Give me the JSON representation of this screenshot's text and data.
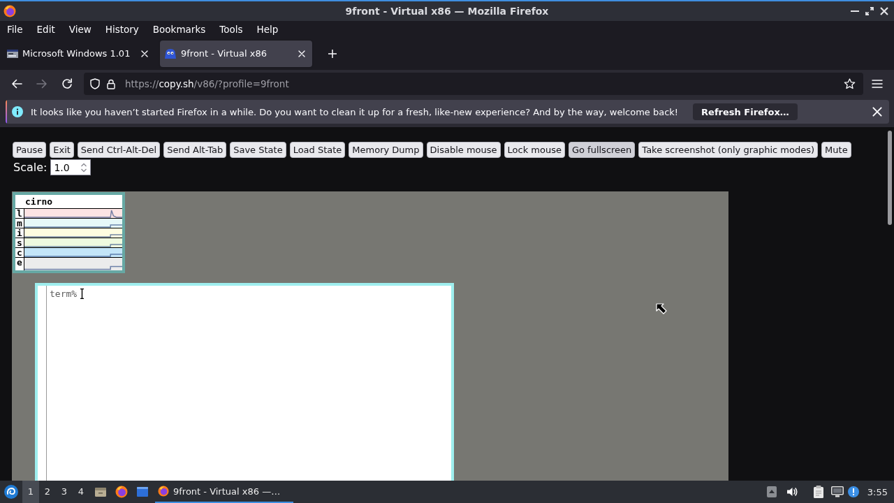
{
  "window": {
    "title": "9front - Virtual x86 — Mozilla Firefox"
  },
  "menu_bar": {
    "items": [
      "File",
      "Edit",
      "View",
      "History",
      "Bookmarks",
      "Tools",
      "Help"
    ]
  },
  "tabs": [
    {
      "title": "Microsoft Windows 1.01",
      "selected": false
    },
    {
      "title": "9front - Virtual x86",
      "selected": true
    }
  ],
  "nav_buttons": [
    {
      "kind": "back",
      "disabled": false
    },
    {
      "kind": "forward",
      "disabled": true
    },
    {
      "kind": "reload",
      "disabled": false
    }
  ],
  "address_bar": {
    "scheme": "https://",
    "host": "copy.sh",
    "path": "/v86/?profile=9front"
  },
  "notification": {
    "message": "It looks like you haven’t started Firefox in a while. Do you want to clean it up for a fresh, like-new experience? And by the way, welcome back!",
    "button": "Refresh Firefox…"
  },
  "page": {
    "buttons": [
      {
        "label": "Pause",
        "hovered": false
      },
      {
        "label": "Exit",
        "hovered": false
      },
      {
        "label": "Send Ctrl-Alt-Del",
        "hovered": false
      },
      {
        "label": "Send Alt-Tab",
        "hovered": false
      },
      {
        "label": "Save State",
        "hovered": false
      },
      {
        "label": "Load State",
        "hovered": false
      },
      {
        "label": "Memory Dump",
        "hovered": false
      },
      {
        "label": "Disable mouse",
        "hovered": false
      },
      {
        "label": "Lock mouse",
        "hovered": false
      },
      {
        "label": "Go fullscreen",
        "hovered": true
      },
      {
        "label": "Take screenshot (only graphic modes)",
        "hovered": false
      },
      {
        "label": "Mute",
        "hovered": false
      }
    ],
    "scale": {
      "label": "Scale:",
      "value": "1.0"
    }
  },
  "vm_screen": {
    "stats_window": {
      "title": "cirno",
      "rows": [
        {
          "label": "l",
          "color": "#fde4e4"
        },
        {
          "label": "m",
          "color": "#e6f8f8"
        },
        {
          "label": "i",
          "color": "#fefde0"
        },
        {
          "label": "s",
          "color": "#eefadf"
        },
        {
          "label": "c",
          "color": "#c3e5f8"
        },
        {
          "label": "e",
          "color": "#ececec"
        }
      ]
    },
    "terminal": {
      "prompt": "term%"
    }
  },
  "taskbar": {
    "workspaces": [
      {
        "label": "1",
        "selected": true
      },
      {
        "label": "2",
        "selected": false
      },
      {
        "label": "3",
        "selected": false
      },
      {
        "label": "4",
        "selected": false
      }
    ],
    "tasks": [
      {
        "title": "9front - Virtual x86 —…",
        "selected": true
      }
    ],
    "clock": "3:55"
  }
}
